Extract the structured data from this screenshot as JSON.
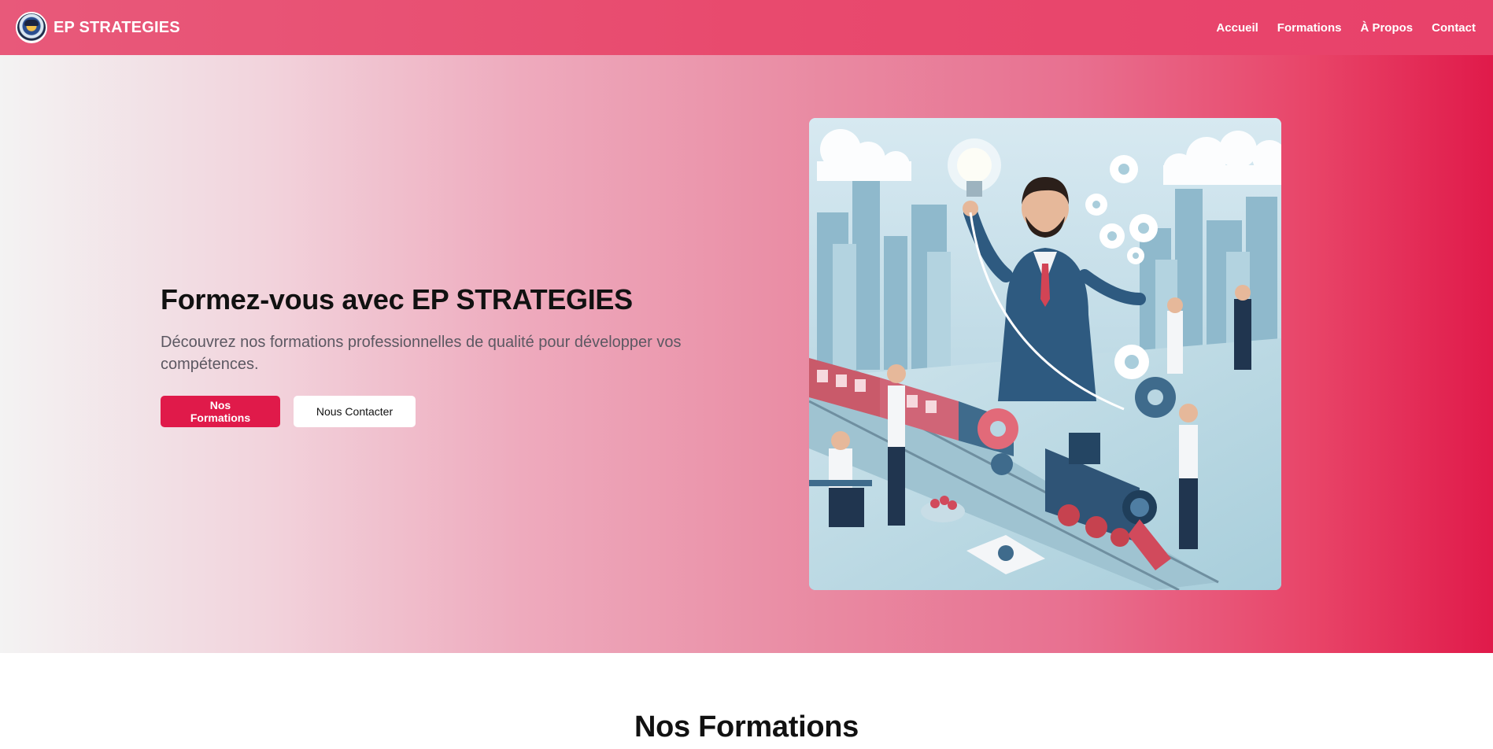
{
  "header": {
    "brand_name": "EP STRATEGIES",
    "nav": [
      {
        "label": "Accueil"
      },
      {
        "label": "Formations"
      },
      {
        "label": "À Propos"
      },
      {
        "label": "Contact"
      }
    ]
  },
  "hero": {
    "title": "Formez-vous avec EP STRATEGIES",
    "subtitle": "Découvrez nos formations professionnelles de qualité pour développer vos compétences.",
    "primary_button": "Nos Formations",
    "secondary_button": "Nous Contacter"
  },
  "formations": {
    "title": "Nos Formations"
  },
  "colors": {
    "brand": "#e84a6e",
    "accent": "#e01a4a"
  }
}
